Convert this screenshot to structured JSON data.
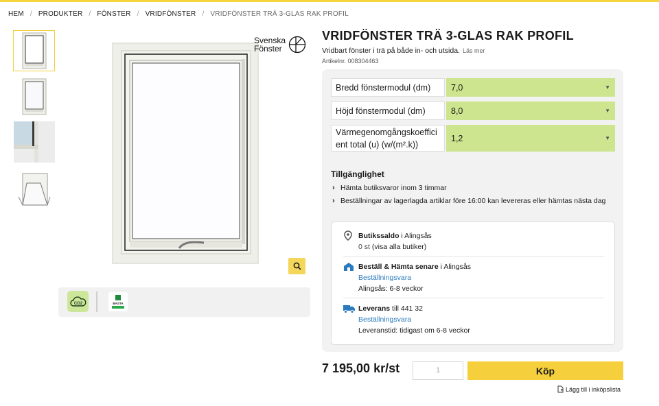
{
  "breadcrumb": [
    "HEM",
    "PRODUKTER",
    "FÖNSTER",
    "VRIDFÖNSTER",
    "VRIDFÖNSTER TRÄ 3-GLAS RAK PROFIL"
  ],
  "brand": {
    "line1": "Svenska",
    "line2": "Fönster"
  },
  "product": {
    "title": "VRIDFÖNSTER TRÄ 3-GLAS RAK PROFIL",
    "subtitle": "Vridbart fönster i trä på både in- och utsida.",
    "read_more": "Läs mer",
    "article_nr": "Artikelnr. 008304463"
  },
  "options": [
    {
      "label": "Bredd fönstermodul (dm)",
      "value": "7,0"
    },
    {
      "label": "Höjd fönstermodul (dm)",
      "value": "8,0"
    },
    {
      "label": "Värmegenomgångskoefficient total (u) (w/(m².k))",
      "value": "1,2"
    }
  ],
  "availability": {
    "title": "Tillgänglighet",
    "items": [
      "Hämta butiksvaror inom 3 timmar",
      "Beställningar av lagerlagda artiklar före 16:00 kan levereras eller hämtas nästa dag"
    ]
  },
  "stock": {
    "store": {
      "title": "Butikssaldo",
      "location": " i Alingsås",
      "detail": "0 st",
      "link": "(visa alla butiker)"
    },
    "order": {
      "title": "Beställ & Hämta senare",
      "location": " i Alingsås",
      "status": "Beställningsvara",
      "detail": "Alingsås: 6-8 veckor"
    },
    "delivery": {
      "title": "Leverans",
      "location": " till 441 32",
      "status": "Beställningsvara",
      "detail": "Leveranstid: tidigast om 6-8 veckor"
    }
  },
  "purchase": {
    "price": "7 195,00 kr/st",
    "quantity_placeholder": "1",
    "buy_label": "Köp",
    "list_label": "Lägg till i inköpslista"
  },
  "badges": {
    "co2": "CO2",
    "basta": "BASTA"
  },
  "colors": {
    "accent_yellow": "#f6d03c",
    "select_green": "#cde58e",
    "link_blue": "#2a7bbd"
  }
}
